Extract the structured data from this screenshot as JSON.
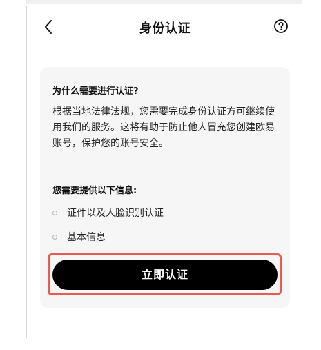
{
  "header": {
    "title": "身份认证",
    "back_icon": "chevron-left-icon",
    "help_icon": "question-circle-icon"
  },
  "card": {
    "question_title": "为什么需要进行认证?",
    "question_body": "根据当地法律法规，您需要完成身份认证方可继续使用我们的服务。这将有助于防止他人冒充您创建欧易账号，保护您的账号安全。",
    "info_title": "您需要提供以下信息:",
    "info_items": [
      {
        "label": "证件以及人脸识别认证"
      },
      {
        "label": "基本信息"
      }
    ]
  },
  "cta": {
    "label": "立即认证",
    "highlight_color": "#e85a52",
    "button_color": "#000000"
  }
}
